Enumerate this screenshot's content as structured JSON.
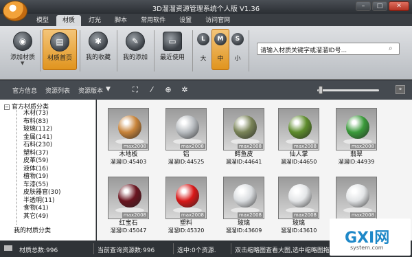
{
  "window": {
    "title": "3D溜溜资源管理系统个人版 V1.36"
  },
  "menu": {
    "tabs": [
      "模型",
      "材质",
      "灯光",
      "脚本",
      "常用软件",
      "设置",
      "访问官网"
    ]
  },
  "ribbon": {
    "buttons": [
      "添加材质",
      "材质首页",
      "我的收藏",
      "我的添加",
      "最近使用"
    ],
    "sizes": [
      {
        "glyph": "L",
        "label": "大"
      },
      {
        "glyph": "M",
        "label": "中"
      },
      {
        "glyph": "S",
        "label": "小"
      }
    ],
    "search_placeholder": "请输入材质关键字或溜溜ID号..."
  },
  "toolbar": {
    "items": [
      "官方信息",
      "资源列表",
      "资源版本"
    ]
  },
  "tree": {
    "root": "官方材质分类",
    "items": [
      "木材(73)",
      "布料(83)",
      "玻璃(112)",
      "金属(141)",
      "石料(230)",
      "塑料(37)",
      "皮革(59)",
      "液体(16)",
      "植物(19)",
      "车漆(55)",
      "皮肤器官(30)",
      "半透明(11)",
      "食物(41)",
      "其它(49)"
    ],
    "user_root": "我的材质分类"
  },
  "materials": [
    {
      "name": "木地板",
      "id": "溜溜ID:45403",
      "tag": "max2008",
      "color": "#c8843a"
    },
    {
      "name": "铝",
      "id": "溜溜ID:44525",
      "tag": "max2008",
      "color": "#b8bcc0"
    },
    {
      "name": "鳄鱼皮",
      "id": "溜溜ID:44641",
      "tag": "max2008",
      "color": "#7a8458"
    },
    {
      "name": "仙人掌",
      "id": "溜溜ID:44650",
      "tag": "max2008",
      "color": "#5e8c2c"
    },
    {
      "name": "翡翠",
      "id": "溜溜ID:44939",
      "tag": "max2008",
      "color": "#3a9a3a"
    },
    {
      "name": "红宝石",
      "id": "溜溜ID:45047",
      "tag": "max2008",
      "color": "#6a1520"
    },
    {
      "name": "塑料",
      "id": "溜溜ID:45320",
      "tag": "max2008",
      "color": "#d81818"
    },
    {
      "name": "玻璃",
      "id": "溜溜ID:43609",
      "tag": "max2008",
      "color": "#dadde0"
    },
    {
      "name": "玻璃",
      "id": "溜溜ID:43610",
      "tag": "max2008",
      "color": "#e4e6e8"
    },
    {
      "name": "",
      "id": "",
      "tag": "max2008",
      "color": "#e2e4e6"
    }
  ],
  "status": {
    "total": "材质总数:996",
    "current": "当前查询资源数:996",
    "selected": "选中:0个资源.",
    "hint": "双击缩略图查看大图,选中缩略图拖入MAX"
  },
  "watermark": {
    "text": "GXI网",
    "sub": "system.com"
  }
}
